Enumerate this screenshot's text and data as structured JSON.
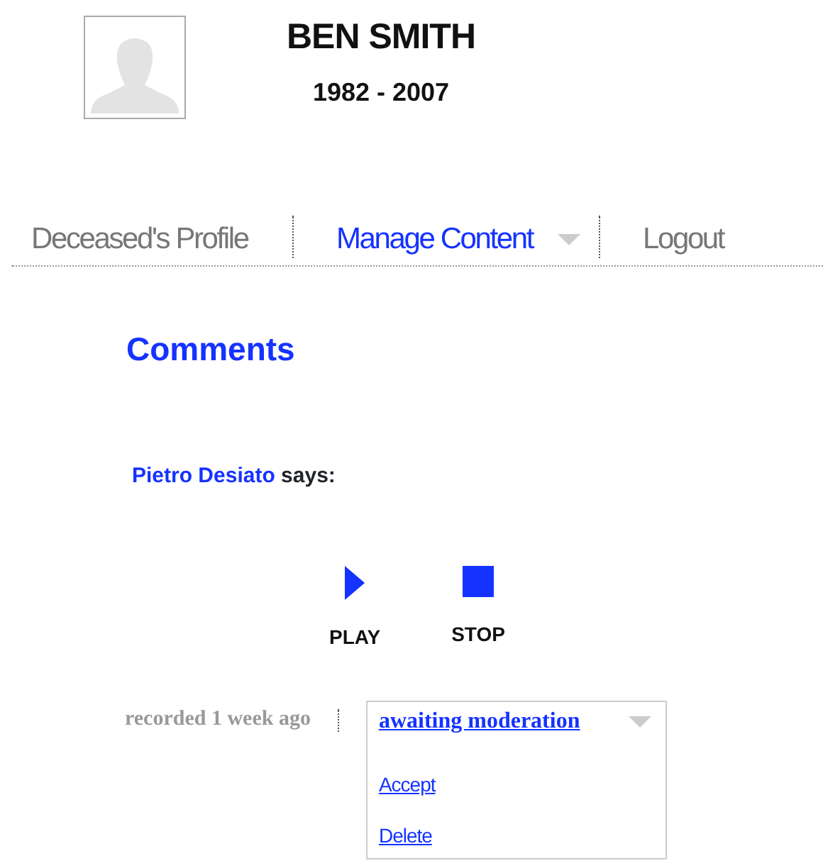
{
  "profile": {
    "name": "BEN SMITH",
    "years": "1982 - 2007"
  },
  "nav": [
    {
      "label": "Deceased's Profile",
      "selected": false,
      "kind": "link"
    },
    {
      "label": "Manage Content",
      "selected": true,
      "kind": "dropdown"
    },
    {
      "label": "Logout",
      "selected": false,
      "kind": "link"
    }
  ],
  "section_title": "Comments",
  "comment": {
    "author": "Pietro Desiato",
    "says": "says:",
    "controls": [
      {
        "kind": "play",
        "label": "PLAY"
      },
      {
        "kind": "stop",
        "label": "STOP"
      }
    ],
    "recorded": "recorded 1 week ago",
    "moderation": {
      "status": "awaiting moderation",
      "expanded": true,
      "options": [
        "Accept",
        "Delete"
      ]
    }
  }
}
